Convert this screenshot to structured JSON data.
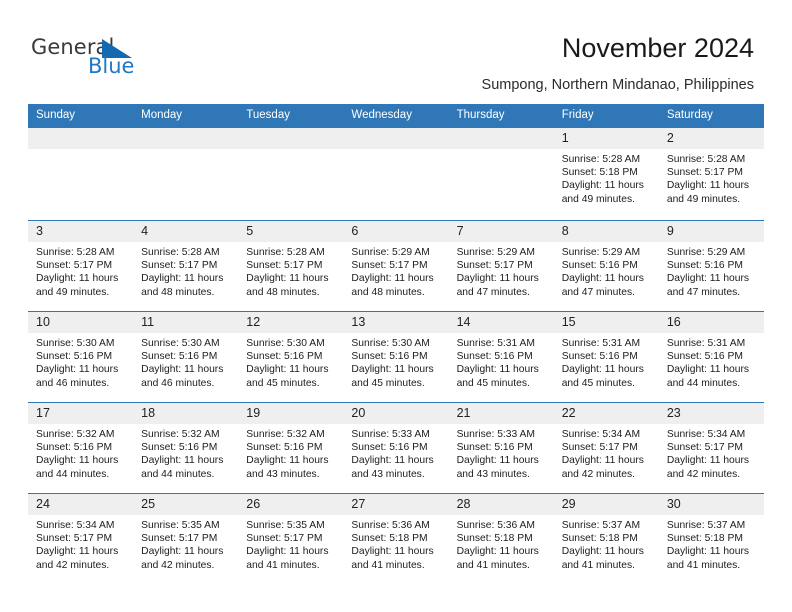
{
  "brand": {
    "name_part1": "General",
    "name_part2": "Blue",
    "triangle_color": "#1569b0",
    "accent_color": "#3077b8"
  },
  "header": {
    "title": "November 2024",
    "subtitle": "Sumpong, Northern Mindanao, Philippines"
  },
  "calendar": {
    "weekday_headers": [
      "Sunday",
      "Monday",
      "Tuesday",
      "Wednesday",
      "Thursday",
      "Friday",
      "Saturday"
    ],
    "weeks": [
      [
        {
          "day": "",
          "empty": true
        },
        {
          "day": "",
          "empty": true
        },
        {
          "day": "",
          "empty": true
        },
        {
          "day": "",
          "empty": true
        },
        {
          "day": "",
          "empty": true
        },
        {
          "day": "1",
          "sunrise": "Sunrise: 5:28 AM",
          "sunset": "Sunset: 5:18 PM",
          "daylight1": "Daylight: 11 hours",
          "daylight2": "and 49 minutes."
        },
        {
          "day": "2",
          "sunrise": "Sunrise: 5:28 AM",
          "sunset": "Sunset: 5:17 PM",
          "daylight1": "Daylight: 11 hours",
          "daylight2": "and 49 minutes."
        }
      ],
      [
        {
          "day": "3",
          "sunrise": "Sunrise: 5:28 AM",
          "sunset": "Sunset: 5:17 PM",
          "daylight1": "Daylight: 11 hours",
          "daylight2": "and 49 minutes."
        },
        {
          "day": "4",
          "sunrise": "Sunrise: 5:28 AM",
          "sunset": "Sunset: 5:17 PM",
          "daylight1": "Daylight: 11 hours",
          "daylight2": "and 48 minutes."
        },
        {
          "day": "5",
          "sunrise": "Sunrise: 5:28 AM",
          "sunset": "Sunset: 5:17 PM",
          "daylight1": "Daylight: 11 hours",
          "daylight2": "and 48 minutes."
        },
        {
          "day": "6",
          "sunrise": "Sunrise: 5:29 AM",
          "sunset": "Sunset: 5:17 PM",
          "daylight1": "Daylight: 11 hours",
          "daylight2": "and 48 minutes."
        },
        {
          "day": "7",
          "sunrise": "Sunrise: 5:29 AM",
          "sunset": "Sunset: 5:17 PM",
          "daylight1": "Daylight: 11 hours",
          "daylight2": "and 47 minutes."
        },
        {
          "day": "8",
          "sunrise": "Sunrise: 5:29 AM",
          "sunset": "Sunset: 5:16 PM",
          "daylight1": "Daylight: 11 hours",
          "daylight2": "and 47 minutes."
        },
        {
          "day": "9",
          "sunrise": "Sunrise: 5:29 AM",
          "sunset": "Sunset: 5:16 PM",
          "daylight1": "Daylight: 11 hours",
          "daylight2": "and 47 minutes."
        }
      ],
      [
        {
          "day": "10",
          "sunrise": "Sunrise: 5:30 AM",
          "sunset": "Sunset: 5:16 PM",
          "daylight1": "Daylight: 11 hours",
          "daylight2": "and 46 minutes."
        },
        {
          "day": "11",
          "sunrise": "Sunrise: 5:30 AM",
          "sunset": "Sunset: 5:16 PM",
          "daylight1": "Daylight: 11 hours",
          "daylight2": "and 46 minutes."
        },
        {
          "day": "12",
          "sunrise": "Sunrise: 5:30 AM",
          "sunset": "Sunset: 5:16 PM",
          "daylight1": "Daylight: 11 hours",
          "daylight2": "and 45 minutes."
        },
        {
          "day": "13",
          "sunrise": "Sunrise: 5:30 AM",
          "sunset": "Sunset: 5:16 PM",
          "daylight1": "Daylight: 11 hours",
          "daylight2": "and 45 minutes."
        },
        {
          "day": "14",
          "sunrise": "Sunrise: 5:31 AM",
          "sunset": "Sunset: 5:16 PM",
          "daylight1": "Daylight: 11 hours",
          "daylight2": "and 45 minutes."
        },
        {
          "day": "15",
          "sunrise": "Sunrise: 5:31 AM",
          "sunset": "Sunset: 5:16 PM",
          "daylight1": "Daylight: 11 hours",
          "daylight2": "and 45 minutes."
        },
        {
          "day": "16",
          "sunrise": "Sunrise: 5:31 AM",
          "sunset": "Sunset: 5:16 PM",
          "daylight1": "Daylight: 11 hours",
          "daylight2": "and 44 minutes."
        }
      ],
      [
        {
          "day": "17",
          "sunrise": "Sunrise: 5:32 AM",
          "sunset": "Sunset: 5:16 PM",
          "daylight1": "Daylight: 11 hours",
          "daylight2": "and 44 minutes."
        },
        {
          "day": "18",
          "sunrise": "Sunrise: 5:32 AM",
          "sunset": "Sunset: 5:16 PM",
          "daylight1": "Daylight: 11 hours",
          "daylight2": "and 44 minutes."
        },
        {
          "day": "19",
          "sunrise": "Sunrise: 5:32 AM",
          "sunset": "Sunset: 5:16 PM",
          "daylight1": "Daylight: 11 hours",
          "daylight2": "and 43 minutes."
        },
        {
          "day": "20",
          "sunrise": "Sunrise: 5:33 AM",
          "sunset": "Sunset: 5:16 PM",
          "daylight1": "Daylight: 11 hours",
          "daylight2": "and 43 minutes."
        },
        {
          "day": "21",
          "sunrise": "Sunrise: 5:33 AM",
          "sunset": "Sunset: 5:16 PM",
          "daylight1": "Daylight: 11 hours",
          "daylight2": "and 43 minutes."
        },
        {
          "day": "22",
          "sunrise": "Sunrise: 5:34 AM",
          "sunset": "Sunset: 5:17 PM",
          "daylight1": "Daylight: 11 hours",
          "daylight2": "and 42 minutes."
        },
        {
          "day": "23",
          "sunrise": "Sunrise: 5:34 AM",
          "sunset": "Sunset: 5:17 PM",
          "daylight1": "Daylight: 11 hours",
          "daylight2": "and 42 minutes."
        }
      ],
      [
        {
          "day": "24",
          "sunrise": "Sunrise: 5:34 AM",
          "sunset": "Sunset: 5:17 PM",
          "daylight1": "Daylight: 11 hours",
          "daylight2": "and 42 minutes."
        },
        {
          "day": "25",
          "sunrise": "Sunrise: 5:35 AM",
          "sunset": "Sunset: 5:17 PM",
          "daylight1": "Daylight: 11 hours",
          "daylight2": "and 42 minutes."
        },
        {
          "day": "26",
          "sunrise": "Sunrise: 5:35 AM",
          "sunset": "Sunset: 5:17 PM",
          "daylight1": "Daylight: 11 hours",
          "daylight2": "and 41 minutes."
        },
        {
          "day": "27",
          "sunrise": "Sunrise: 5:36 AM",
          "sunset": "Sunset: 5:18 PM",
          "daylight1": "Daylight: 11 hours",
          "daylight2": "and 41 minutes."
        },
        {
          "day": "28",
          "sunrise": "Sunrise: 5:36 AM",
          "sunset": "Sunset: 5:18 PM",
          "daylight1": "Daylight: 11 hours",
          "daylight2": "and 41 minutes."
        },
        {
          "day": "29",
          "sunrise": "Sunrise: 5:37 AM",
          "sunset": "Sunset: 5:18 PM",
          "daylight1": "Daylight: 11 hours",
          "daylight2": "and 41 minutes."
        },
        {
          "day": "30",
          "sunrise": "Sunrise: 5:37 AM",
          "sunset": "Sunset: 5:18 PM",
          "daylight1": "Daylight: 11 hours",
          "daylight2": "and 41 minutes."
        }
      ]
    ]
  }
}
